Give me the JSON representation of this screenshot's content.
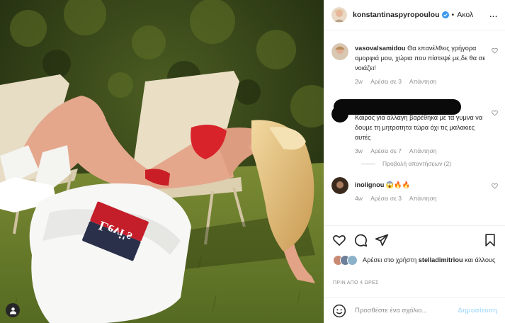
{
  "header": {
    "username": "konstantinaspyropoulou",
    "separator": "•",
    "follow_label": "Ακολ",
    "more_label": "...",
    "avatar_icon": "profile-avatar",
    "verified_icon": "verified-badge-icon"
  },
  "comments": [
    {
      "username": "vasovalsamidou",
      "text": "Θα επανέλθεις γρήγορα ομορφιά μου, χώρια που πίστεψέ με,δε θα σε νοιάζει!",
      "time": "2w",
      "likes": "Αρέσει σε 3",
      "reply": "Απάντηση"
    },
    {
      "username": "",
      "text": "Καιρος για αλλαγη βαρέθηκα με τα γυμνα να δουμε τη μητροτητα τώρα όχι τις μαλακιες αυτές",
      "time": "3w",
      "likes": "Αρέσει σε 7",
      "reply": "Απάντηση"
    },
    {
      "username": "inolignou",
      "text": "😱🔥🔥",
      "time": "4w",
      "likes": "Αρέσει σε 3",
      "reply": "Απάντηση"
    }
  ],
  "view_replies": "Προβολή απαντήσεων (2)",
  "likes": {
    "prefix": "Αρέσει στο χρήστη",
    "user": "stelladimitriou",
    "suffix": "και άλλους"
  },
  "timestamp": "ΠΡΙΝ ΑΠΟ 4 ΩΡΕΣ",
  "composer": {
    "placeholder": "Προσθέστε ένα σχόλιο...",
    "post_label": "Δημοσίευση"
  },
  "photo": {
    "brand_text": "Levi's"
  },
  "colors": {
    "verified": "#3897f0",
    "post_disabled": "#b2dffc",
    "secondary_text": "#8e8e8e"
  }
}
